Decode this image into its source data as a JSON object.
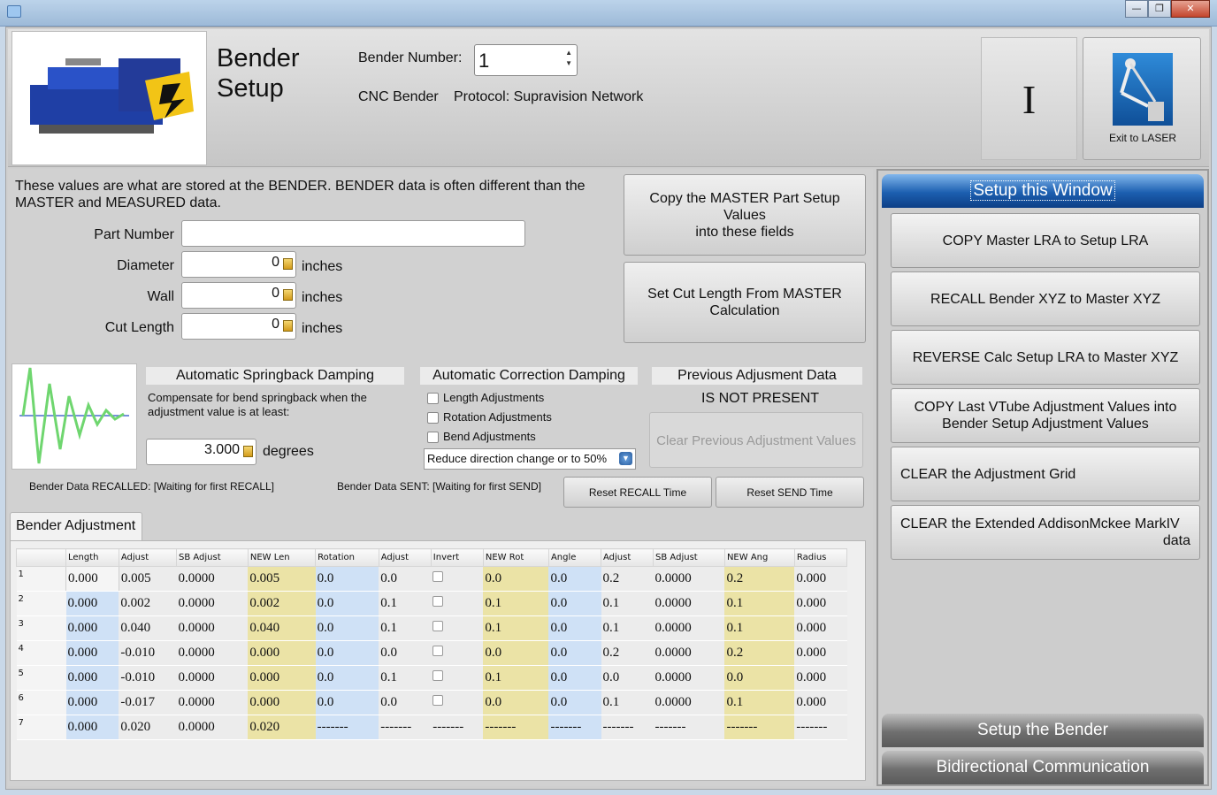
{
  "header": {
    "title_line1": "Bender",
    "title_line2": "Setup",
    "bender_number_label": "Bender Number:",
    "bender_number_value": "1",
    "bender_type": "CNC Bender",
    "protocol": "Protocol: Supravision Network",
    "cursor_glyph": "I",
    "exit_button": "Exit to LASER"
  },
  "intro": {
    "line1": "These values are what are stored at the BENDER.  BENDER data is often different than the",
    "line2": "MASTER and MEASURED data."
  },
  "fields": {
    "part_number_label": "Part Number",
    "part_number_value": "",
    "diameter_label": "Diameter",
    "diameter_value": "0",
    "wall_label": "Wall",
    "wall_value": "0",
    "cut_length_label": "Cut Length",
    "cut_length_value": "0",
    "unit": "inches"
  },
  "buttons": {
    "copy_master_line1": "Copy the MASTER Part Setup Values",
    "copy_master_line2": "into these fields",
    "set_cut_line1": "Set Cut Length From MASTER",
    "set_cut_line2": "Calculation",
    "clear_prev": "Clear Previous Adjustment Values",
    "reset_recall": "Reset RECALL Time",
    "reset_send": "Reset SEND Time"
  },
  "springback": {
    "heading": "Automatic Springback Damping",
    "desc_line1": "Compensate for bend springback when the",
    "desc_line2": "adjustment value is at least:",
    "value": "3.000",
    "unit": "degrees"
  },
  "correction": {
    "heading": "Automatic Correction Damping",
    "options": [
      "Length Adjustments",
      "Rotation Adjustments",
      "Bend Adjustments"
    ],
    "select_value": "Reduce direction change or to 50%"
  },
  "previous": {
    "heading": "Previous Adjusment Data",
    "status": "IS NOT PRESENT"
  },
  "status": {
    "recalled": "Bender Data RECALLED:  [Waiting for first RECALL]",
    "sent": "Bender Data SENT:  [Waiting for first SEND]"
  },
  "tab": {
    "label": "Bender Adjustment"
  },
  "grid": {
    "columns": [
      "",
      "Length",
      "Adjust",
      "SB Adjust",
      "NEW Len",
      "Rotation",
      "Adjust",
      "Invert",
      "NEW Rot",
      "Angle",
      "Adjust",
      "SB Adjust",
      "NEW Ang",
      "Radius"
    ],
    "rows": [
      [
        "1",
        "0.000",
        "0.005",
        "0.0000",
        "0.005",
        "0.0",
        "0.0",
        "cb",
        "0.0",
        "0.0",
        "0.2",
        "0.0000",
        "0.2",
        "0.000"
      ],
      [
        "2",
        "0.000",
        "0.002",
        "0.0000",
        "0.002",
        "0.0",
        "0.1",
        "cb",
        "0.1",
        "0.0",
        "0.1",
        "0.0000",
        "0.1",
        "0.000"
      ],
      [
        "3",
        "0.000",
        "0.040",
        "0.0000",
        "0.040",
        "0.0",
        "0.1",
        "cb",
        "0.1",
        "0.0",
        "0.1",
        "0.0000",
        "0.1",
        "0.000"
      ],
      [
        "4",
        "0.000",
        "-0.010",
        "0.0000",
        "0.000",
        "0.0",
        "0.0",
        "cb",
        "0.0",
        "0.0",
        "0.2",
        "0.0000",
        "0.2",
        "0.000"
      ],
      [
        "5",
        "0.000",
        "-0.010",
        "0.0000",
        "0.000",
        "0.0",
        "0.1",
        "cb",
        "0.1",
        "0.0",
        "0.0",
        "0.0000",
        "0.0",
        "0.000"
      ],
      [
        "6",
        "0.000",
        "-0.017",
        "0.0000",
        "0.000",
        "0.0",
        "0.0",
        "cb",
        "0.0",
        "0.0",
        "0.1",
        "0.0000",
        "0.1",
        "0.000"
      ],
      [
        "7",
        "0.000",
        "0.020",
        "0.0000",
        "0.020",
        "-------",
        "-------",
        "-------",
        "-------",
        "-------",
        "-------",
        "-------",
        "-------",
        "-------"
      ]
    ]
  },
  "right_panel": {
    "setup_window": "Setup this Window",
    "copy_lra": "COPY Master LRA to Setup LRA",
    "recall_xyz": "RECALL Bender XYZ to Master XYZ",
    "reverse_calc": "REVERSE Calc Setup LRA to Master XYZ",
    "copy_vtube_line1": "COPY Last VTube Adjustment Values into",
    "copy_vtube_line2": "Bender Setup Adjustment Values",
    "clear_grid": "CLEAR the Adjustment Grid",
    "clear_ext_line1": "CLEAR the Extended AddisonMckee MarkIV",
    "clear_ext_line2": "data",
    "setup_bender": "Setup the Bender",
    "bidirectional": "Bidirectional Communication"
  }
}
